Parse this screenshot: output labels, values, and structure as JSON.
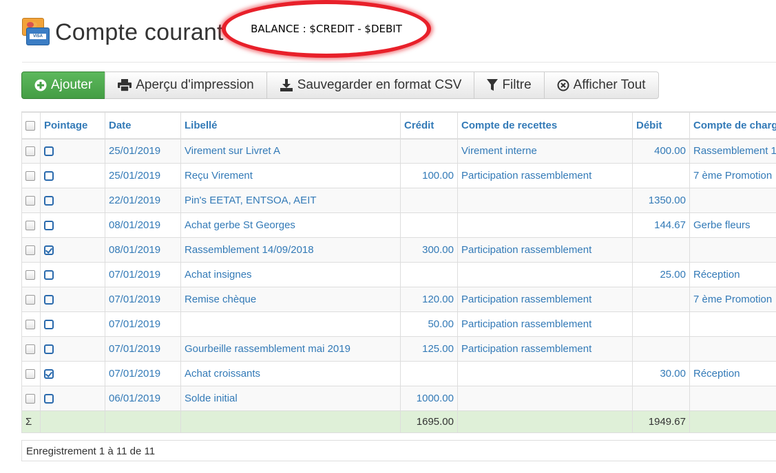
{
  "header": {
    "title": "Compte courant",
    "annotation": "BALANCE : $CREDIT - $DEBIT"
  },
  "toolbar": {
    "add_label": "Ajouter",
    "print_label": "Aperçu d'impression",
    "csv_label": "Sauvegarder en format CSV",
    "filter_label": "Filtre",
    "show_all_label": "Afficher Tout"
  },
  "table": {
    "columns": [
      "Pointage",
      "Date",
      "Libellé",
      "Crédit",
      "Compte de recettes",
      "Débit",
      "Compte de charg"
    ],
    "rows": [
      {
        "checked": false,
        "date": "25/01/2019",
        "label": "Virement sur Livret A",
        "credit": "",
        "income": "Virement interne",
        "debit": "400.00",
        "expense": "Rassemblement 1"
      },
      {
        "checked": false,
        "date": "25/01/2019",
        "label": "Reçu Virement",
        "credit": "100.00",
        "income": "Participation rassemblement",
        "debit": "",
        "expense": "7 ème Promotion"
      },
      {
        "checked": false,
        "date": "22/01/2019",
        "label": "Pin's EETAT, ENTSOA, AEIT",
        "credit": "",
        "income": "",
        "debit": "1350.00",
        "expense": ""
      },
      {
        "checked": false,
        "date": "08/01/2019",
        "label": "Achat gerbe St Georges",
        "credit": "",
        "income": "",
        "debit": "144.67",
        "expense": "Gerbe fleurs"
      },
      {
        "checked": true,
        "date": "08/01/2019",
        "label": "Rassemblement 14/09/2018",
        "credit": "300.00",
        "income": "Participation rassemblement",
        "debit": "",
        "expense": ""
      },
      {
        "checked": false,
        "date": "07/01/2019",
        "label": "Achat insignes",
        "credit": "",
        "income": "",
        "debit": "25.00",
        "expense": "Réception"
      },
      {
        "checked": false,
        "date": "07/01/2019",
        "label": "Remise chèque",
        "credit": "120.00",
        "income": "Participation rassemblement",
        "debit": "",
        "expense": "7 ème Promotion"
      },
      {
        "checked": false,
        "date": "07/01/2019",
        "label": "",
        "credit": "50.00",
        "income": "Participation rassemblement",
        "debit": "",
        "expense": ""
      },
      {
        "checked": false,
        "date": "07/01/2019",
        "label": "Gourbeille rassemblement mai 2019",
        "credit": "125.00",
        "income": "Participation rassemblement",
        "debit": "",
        "expense": ""
      },
      {
        "checked": true,
        "date": "07/01/2019",
        "label": "Achat croissants",
        "credit": "",
        "income": "",
        "debit": "30.00",
        "expense": "Réception"
      },
      {
        "checked": false,
        "date": "06/01/2019",
        "label": "Solde initial",
        "credit": "1000.00",
        "income": "",
        "debit": "",
        "expense": ""
      }
    ],
    "totals": {
      "symbol": "Σ",
      "credit": "1695.00",
      "debit": "1949.67"
    }
  },
  "footer": {
    "records": "Enregistrement 1 à 11 de 11"
  },
  "colors": {
    "link": "#337ab7",
    "success": "#5cb85c",
    "sum_row": "#dff0d8",
    "annotation": "#e8202a"
  }
}
